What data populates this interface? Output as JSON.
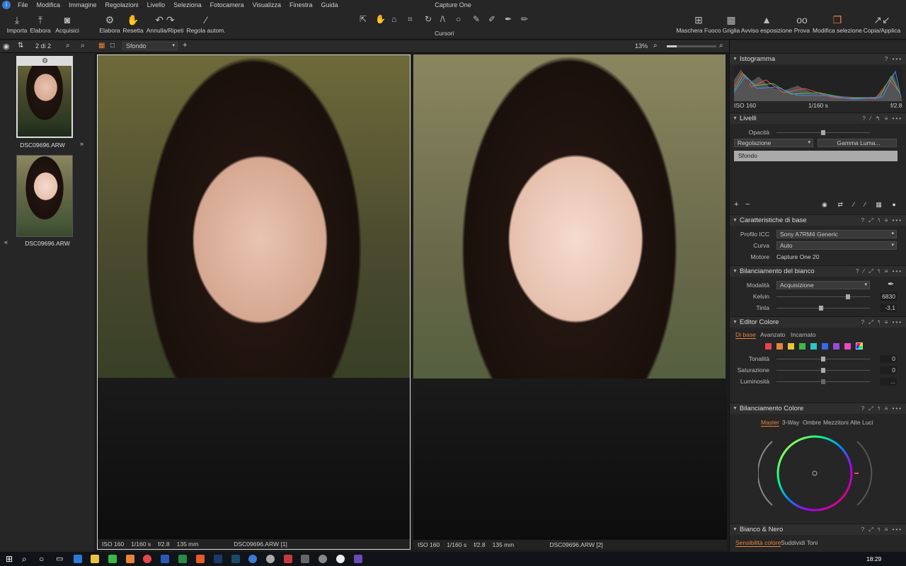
{
  "app": {
    "title": "Capture One"
  },
  "menu": [
    "File",
    "Modifica",
    "Immagine",
    "Regolazioni",
    "Livello",
    "Seleziona",
    "Fotocamera",
    "Visualizza",
    "Finestra",
    "Guida"
  ],
  "toolbar": {
    "left": [
      {
        "label": "Importa",
        "icon": "download-icon",
        "glyph": "⤓"
      },
      {
        "label": "Elabora",
        "icon": "upload-icon",
        "glyph": "⤒"
      },
      {
        "label": "Acquisici",
        "icon": "camera-icon",
        "glyph": "◙"
      },
      {
        "label": "Elabora",
        "icon": "gear-icon",
        "glyph": "⚙"
      },
      {
        "label": "Resetta",
        "icon": "reset-icon",
        "glyph": "✋"
      },
      {
        "label": "Annulla/Ripeti",
        "icon": "undo-icon",
        "glyph": "↶ ↷"
      },
      {
        "label": "Regola autom.",
        "icon": "wand-icon",
        "glyph": "⁄"
      }
    ],
    "cursors_label": "Cursori",
    "right": [
      {
        "label": "Maschera Fuoco",
        "icon": "focus-mask-icon",
        "glyph": "⊞"
      },
      {
        "label": "Griglia",
        "icon": "grid-icon",
        "glyph": "▦"
      },
      {
        "label": "Avviso esposizione",
        "icon": "warning-icon",
        "glyph": "▲"
      },
      {
        "label": "Prova",
        "icon": "glasses-icon",
        "glyph": "oo"
      },
      {
        "label": "Modifica selezione",
        "icon": "layers-icon",
        "glyph": "❐"
      },
      {
        "label": "Copia/Applica",
        "icon": "copy-apply-icon",
        "glyph": "↗↙"
      }
    ]
  },
  "subbar": {
    "count": "2 di 2",
    "variant": "Sfondo",
    "zoom": "13%"
  },
  "browser": {
    "items": [
      {
        "name": "DSC09696.ARW"
      },
      {
        "name": "DSC09696.ARW"
      }
    ]
  },
  "viewer": [
    {
      "iso": "ISO 160",
      "shutter": "1/160 s",
      "aperture": "f/2.8",
      "focal": "135 mm",
      "name": "DSC09696.ARW [1]"
    },
    {
      "iso": "ISO 160",
      "shutter": "1/160 s",
      "aperture": "f/2.8",
      "focal": "135 mm",
      "name": "DSC09696.ARW [2]"
    }
  ],
  "panels": {
    "histogram": {
      "title": "Istogramma",
      "iso": "ISO 160",
      "shutter": "1/160 s",
      "aperture": "f/2.8"
    },
    "layers": {
      "title": "Livelli",
      "opacity_label": "Opacità",
      "adjust": "Regolazione",
      "gamma": "Gamma Luma...",
      "layer_name": "Sfondo"
    },
    "basic": {
      "title": "Caratteristiche di base",
      "icc_label": "Profilo ICC",
      "icc": "Sony A7RM4 Generic",
      "curve_label": "Curva",
      "curve": "Auto",
      "engine_label": "Motore",
      "engine": "Capture One 20"
    },
    "wb": {
      "title": "Bilanciamento del bianco",
      "mode_label": "Modalità",
      "mode": "Acquisizione",
      "kelvin_label": "Kelvin",
      "kelvin": "6830",
      "tint_label": "Tinta",
      "tint": "-3,1"
    },
    "color_editor": {
      "title": "Editor Colore",
      "tabs": [
        "Di base",
        "Avanzato",
        "Incarnato"
      ],
      "hue_label": "Tonalità",
      "hue": "0",
      "sat_label": "Saturazione",
      "sat": "0",
      "lum_label": "Luminosità",
      "lum": "..."
    },
    "color_balance": {
      "title": "Bilanciamento Colore",
      "tabs": [
        "Master",
        "3-Way",
        "Ombre",
        "Mezzitoni",
        "Alte Luci"
      ]
    },
    "bw": {
      "title": "Bianco & Nero",
      "tabs": [
        "Sensibilità colore",
        "Suddividi Toni"
      ]
    }
  },
  "swatches": [
    "#e8454a",
    "#e8843a",
    "#e8c43a",
    "#3ab848",
    "#2ac8c8",
    "#3a6ae8",
    "#9a4ad8",
    "#e84ac0"
  ],
  "taskbar": {
    "time": "18:29"
  }
}
